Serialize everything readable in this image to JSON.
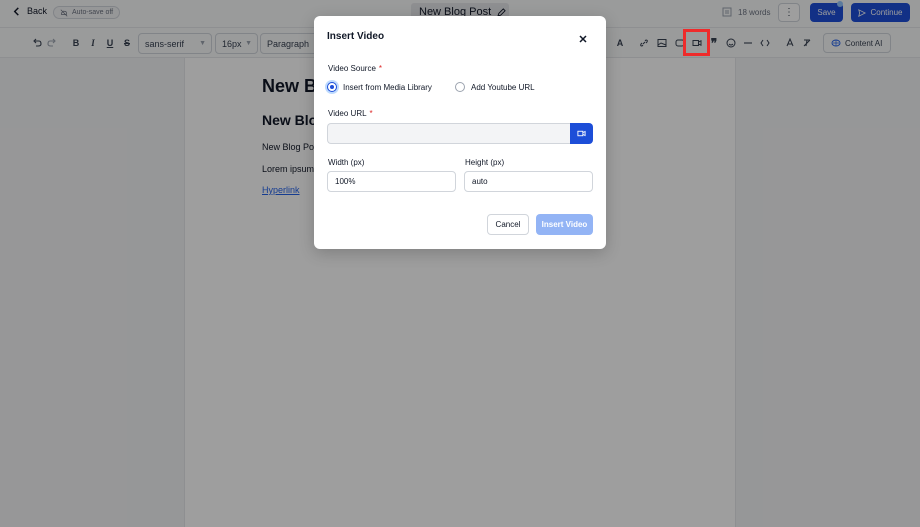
{
  "header": {
    "back_label": "Back",
    "autosave_label": "Auto-save off",
    "post_title": "New Blog Post",
    "word_count": "18 words",
    "more_label": "⋮",
    "save_label": "Save",
    "continue_label": "Continue"
  },
  "toolbar": {
    "font_family": "sans-serif",
    "font_size": "16px",
    "block_type": "Paragraph",
    "bold": "B",
    "italic": "I",
    "underline": "U",
    "strike": "S",
    "text_color": "A",
    "content_ai_label": "Content AI",
    "highlighted_tool": "insert-video"
  },
  "editor": {
    "heading1": "New Blog Post",
    "heading2": "New Blog Post",
    "paragraph1": "New Blog Post",
    "paragraph2": "Lorem ipsum",
    "link_text": "Hyperlink"
  },
  "modal": {
    "title": "Insert Video",
    "source_label": "Video Source",
    "required_mark": "*",
    "source_options": [
      {
        "label": "Insert from Media Library",
        "checked": true
      },
      {
        "label": "Add Youtube URL",
        "checked": false
      }
    ],
    "url_label": "Video URL",
    "url_value": "",
    "width_label": "Width (px)",
    "width_value": "100%",
    "height_label": "Height (px)",
    "height_value": "auto",
    "cancel_label": "Cancel",
    "insert_label": "Insert Video"
  },
  "colors": {
    "primary": "#1d4ed8",
    "primary_disabled": "#93b4f5",
    "highlight_box": "#ef2b2b",
    "required": "#dc2626"
  }
}
